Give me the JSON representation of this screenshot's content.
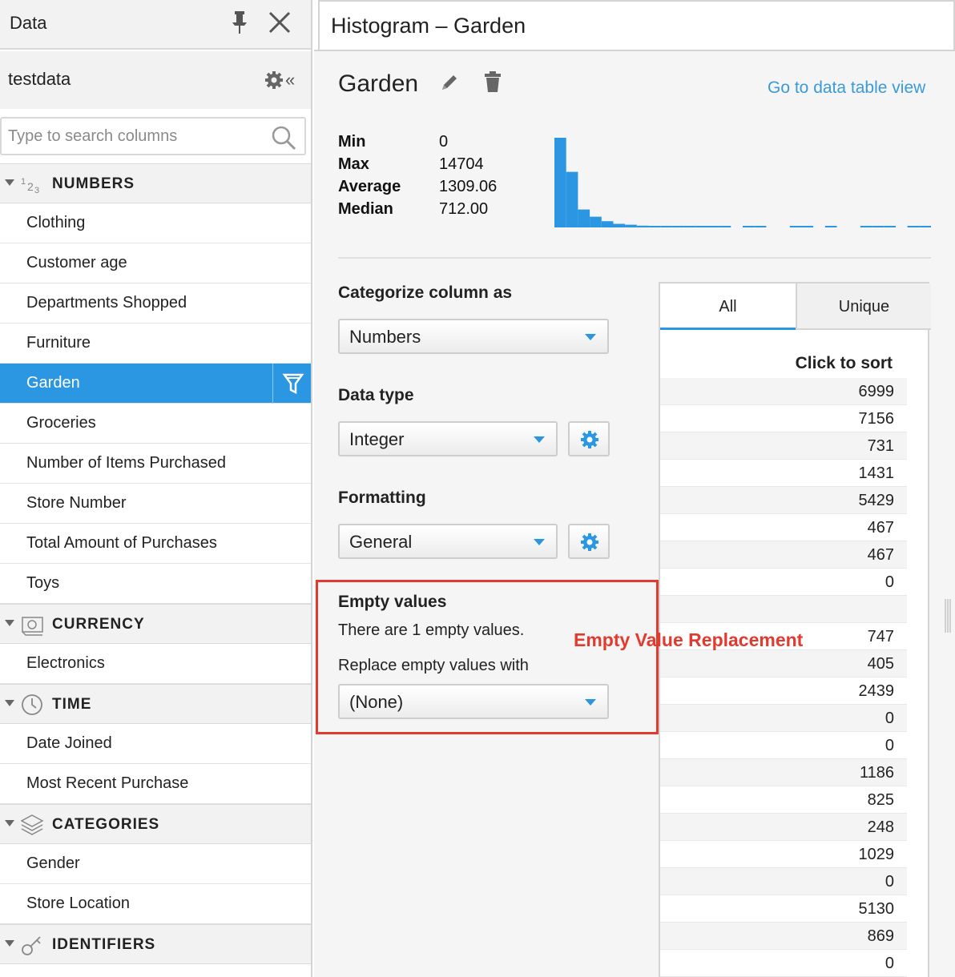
{
  "left_panel": {
    "title": "Data",
    "dataset": "testdata",
    "search_placeholder": "Type to search columns",
    "sections": [
      {
        "label": "NUMBERS",
        "icon": "numbers-icon",
        "items": [
          {
            "label": "Clothing"
          },
          {
            "label": "Customer age"
          },
          {
            "label": "Departments Shopped"
          },
          {
            "label": "Furniture"
          },
          {
            "label": "Garden",
            "active": true
          },
          {
            "label": "Groceries"
          },
          {
            "label": "Number of Items Purchased"
          },
          {
            "label": "Store Number"
          },
          {
            "label": "Total Amount of Purchases"
          },
          {
            "label": "Toys"
          }
        ]
      },
      {
        "label": "CURRENCY",
        "icon": "currency-icon",
        "items": [
          {
            "label": "Electronics"
          }
        ]
      },
      {
        "label": "TIME",
        "icon": "clock-icon",
        "items": [
          {
            "label": "Date Joined"
          },
          {
            "label": "Most Recent Purchase"
          }
        ]
      },
      {
        "label": "CATEGORIES",
        "icon": "layers-icon",
        "items": [
          {
            "label": "Gender"
          },
          {
            "label": "Store Location"
          }
        ]
      },
      {
        "label": "IDENTIFIERS",
        "icon": "key-icon",
        "items": []
      }
    ]
  },
  "window": {
    "title": "Histogram – Garden"
  },
  "column": {
    "name": "Garden",
    "goto_link": "Go to data table view",
    "stats": [
      {
        "label": "Min",
        "value": "0"
      },
      {
        "label": "Max",
        "value": "14704"
      },
      {
        "label": "Average",
        "value": "1309.06"
      },
      {
        "label": "Median",
        "value": "712.00"
      }
    ],
    "histogram": {
      "bars": [
        1.0,
        0.62,
        0.2,
        0.12,
        0.07,
        0.04,
        0.03,
        0.02,
        0.015,
        0.01,
        0.008,
        0.006,
        0.005,
        0.004,
        0.003,
        0.0,
        0.003,
        0.002,
        0.0,
        0.0,
        0.003,
        0.002,
        0.0,
        0.002,
        0.0,
        0.0,
        0.003,
        0.002,
        0.002,
        0.0,
        0.002,
        0.002
      ],
      "color": "#2b97e2"
    }
  },
  "settings": {
    "categorize_label": "Categorize column as",
    "categorize_value": "Numbers",
    "datatype_label": "Data type",
    "datatype_value": "Integer",
    "formatting_label": "Formatting",
    "formatting_value": "General",
    "empty_heading": "Empty values",
    "empty_count_text": "There are 1 empty values.",
    "replace_label": "Replace empty values with",
    "replace_value": "(None)",
    "annotation": "Empty Value Replacement",
    "annotation_color": "#e23a2e"
  },
  "values_panel": {
    "tabs": [
      "All",
      "Unique"
    ],
    "sort_label": "Click to sort",
    "values": [
      "6999",
      "7156",
      "731",
      "1431",
      "5429",
      "467",
      "467",
      "0",
      "",
      "747",
      "405",
      "2439",
      "0",
      "0",
      "1186",
      "825",
      "248",
      "1029",
      "0",
      "5130",
      "869",
      "0"
    ]
  }
}
